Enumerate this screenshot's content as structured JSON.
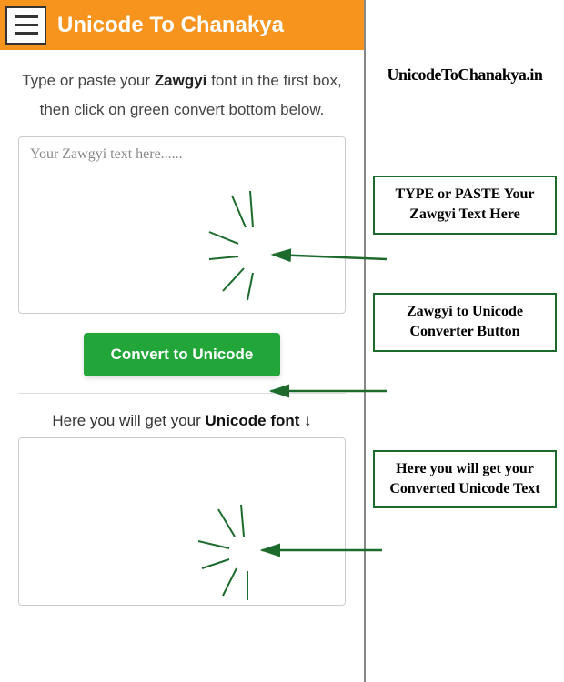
{
  "header": {
    "title": "Unicode To Chanakya"
  },
  "instructions": {
    "pre": "Type or paste your ",
    "bold": "Zawgyi",
    "post": " font in the first box, then click on green convert bottom below."
  },
  "input": {
    "placeholder": "Your Zawgyi text here......"
  },
  "convert": {
    "label": "Convert to Unicode"
  },
  "output_label": {
    "pre": "Here you will get your ",
    "bold": "Unicode font",
    "post": " ↓"
  },
  "site_name": "UnicodeToChanakya.in",
  "callouts": {
    "c1": "TYPE or PASTE Your Zawgyi Text Here",
    "c2": "Zawgyi to Unicode Converter Button",
    "c3": "Here you will get your Converted Unicode Text"
  }
}
